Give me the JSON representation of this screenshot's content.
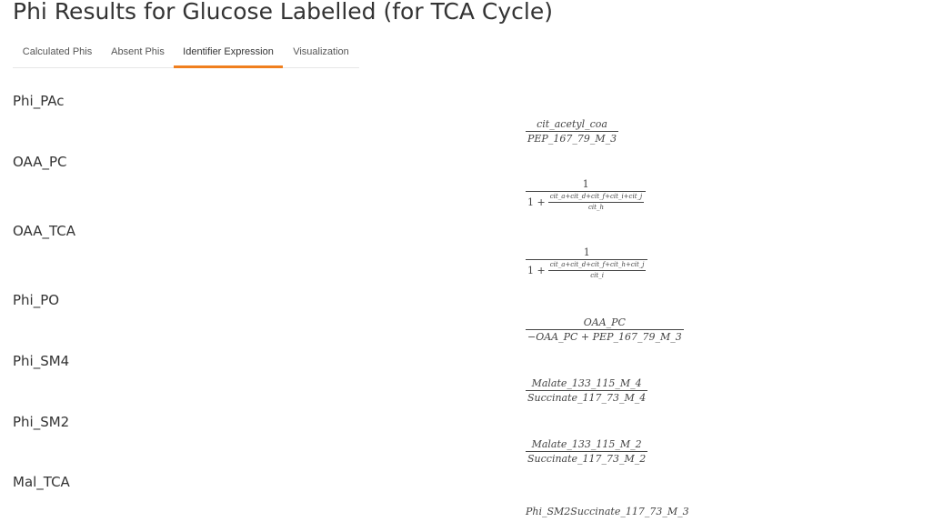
{
  "page": {
    "title": "Phi Results for Glucose Labelled (for TCA Cycle)"
  },
  "tabs": [
    {
      "label": "Calculated Phis",
      "active": false
    },
    {
      "label": "Absent Phis",
      "active": false
    },
    {
      "label": "Identifier Expression",
      "active": true
    },
    {
      "label": "Visualization",
      "active": false
    }
  ],
  "colors": {
    "active_tab_indicator": "#f07f1e",
    "text": "#333333",
    "divider": "#e6e6e6"
  },
  "rows": [
    {
      "label": "Phi_PAc",
      "expr": {
        "numerator": "cit_acetyl_coa",
        "denominator": "PEP_167_79_M_3"
      }
    },
    {
      "label": "OAA_PC",
      "expr": {
        "numerator": "1",
        "denominator_lead": "1 +",
        "inner_numerator": "cit_a+cit_d+cit_f+cit_i+cit_j",
        "inner_denominator": "cit_h"
      }
    },
    {
      "label": "OAA_TCA",
      "expr": {
        "numerator": "1",
        "denominator_lead": "1 +",
        "inner_numerator": "cit_a+cit_d+cit_f+cit_h+cit_j",
        "inner_denominator": "cit_i"
      }
    },
    {
      "label": "Phi_PO",
      "expr": {
        "numerator": "OAA_PC",
        "denominator": "−OAA_PC + PEP_167_79_M_3"
      }
    },
    {
      "label": "Phi_SM4",
      "expr": {
        "numerator": "Malate_133_115_M_4",
        "denominator": "Succinate_117_73_M_4"
      }
    },
    {
      "label": "Phi_SM2",
      "expr": {
        "numerator": "Malate_133_115_M_2",
        "denominator": "Succinate_117_73_M_2"
      }
    },
    {
      "label": "Mal_TCA",
      "expr": {
        "text": "Phi_SM2Succinate_117_73_M_3"
      }
    }
  ]
}
